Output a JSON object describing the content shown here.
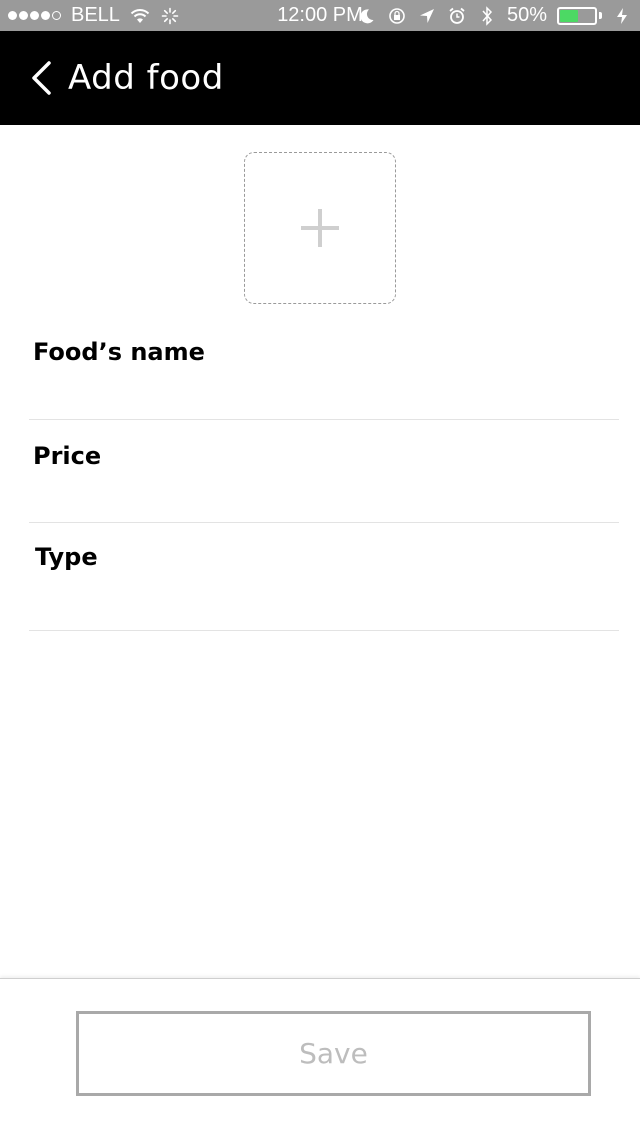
{
  "status_bar": {
    "carrier": "BELL",
    "time": "12:00 PM",
    "battery_percent": "50%",
    "battery_level": 0.5,
    "icons": [
      "signal-dots",
      "wifi-icon",
      "activity-spinner-icon",
      "moon-icon",
      "rotation-lock-icon",
      "location-icon",
      "alarm-icon",
      "bluetooth-icon",
      "battery-icon",
      "charging-bolt-icon"
    ]
  },
  "nav": {
    "back_icon": "chevron-left-icon",
    "title": "Add food"
  },
  "photo": {
    "icon": "plus-icon"
  },
  "form": {
    "fields": [
      {
        "label": "Food’s name",
        "value": ""
      },
      {
        "label": "Price",
        "value": ""
      },
      {
        "label": "Type",
        "value": ""
      }
    ]
  },
  "footer": {
    "save_label": "Save"
  },
  "colors": {
    "nav_background": "#000000",
    "status_background": "#9a9a9a",
    "battery_fill": "#4cd964",
    "button_border": "#a9a9a9",
    "button_text": "#bdbdbd"
  }
}
